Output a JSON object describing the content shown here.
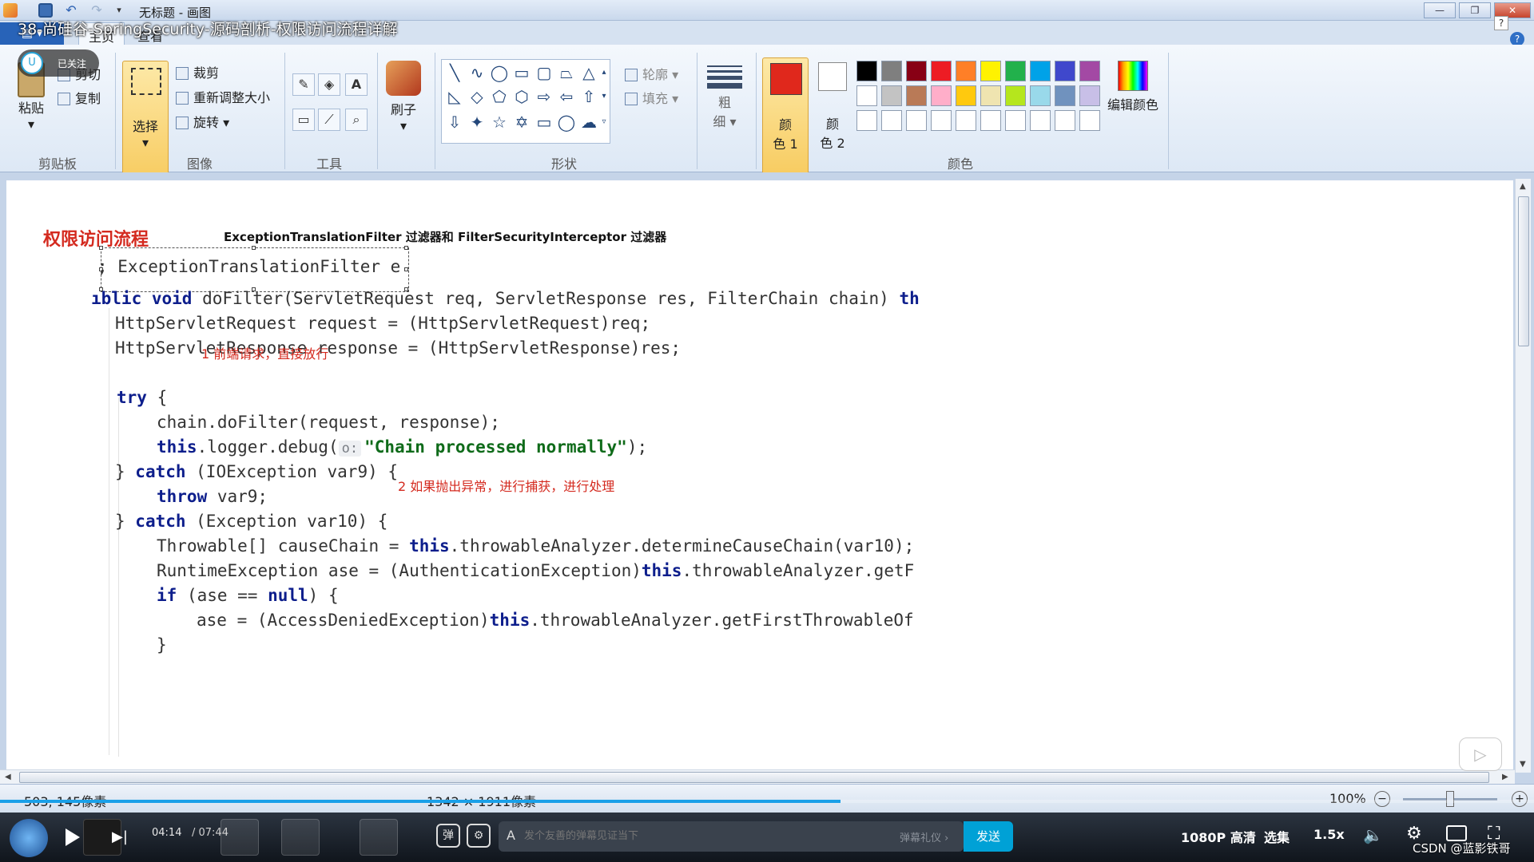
{
  "window": {
    "title": "无标题 - 画图"
  },
  "video": {
    "title": "38-尚硅谷-SpringSecurity-源码剖析-权限访问流程详解",
    "uploader_status": "已关注",
    "uploader_avatar_text": "U"
  },
  "ribbon": {
    "tabs": {
      "home": "主页",
      "view": "查看"
    },
    "clipboard": {
      "paste": "粘贴",
      "cut": "剪切",
      "copy": "复制",
      "label": "剪贴板"
    },
    "image": {
      "select": "选择",
      "crop": "裁剪",
      "resize": "重新调整大小",
      "rotate": "旋转",
      "label": "图像"
    },
    "tools": {
      "label": "工具"
    },
    "brushes": {
      "label": "刷子"
    },
    "shapes": {
      "outline": "轮廓",
      "fill": "填充",
      "label": "形状"
    },
    "size": {
      "label_top": "粗",
      "label_bottom": "细"
    },
    "colors": {
      "color1_top": "颜",
      "color1_bottom": "色 1",
      "color2_top": "颜",
      "color2_bottom": "色 2",
      "edit": "编辑颜色",
      "label": "颜色",
      "color1_value": "#e0281c",
      "palette_row1": [
        "#000000",
        "#7f7f7f",
        "#880015",
        "#ed1c24",
        "#ff7f27",
        "#fff200",
        "#22b14c",
        "#00a2e8",
        "#3f48cc",
        "#a349a4"
      ],
      "palette_row2": [
        "#ffffff",
        "#c3c3c3",
        "#b97a57",
        "#ffaec9",
        "#ffc90e",
        "#efe4b0",
        "#b5e61d",
        "#99d9ea",
        "#7092be",
        "#c8bfe7"
      ]
    }
  },
  "canvas": {
    "heading": "权限访问流程",
    "subheading": "ExceptionTranslationFilter 过滤器和 FilterSecurityInterceptor 过滤器",
    "class_line": "; ExceptionTranslationFilter e",
    "code": {
      "l1_kw": "ıblic void",
      "l1_rest": " doFilter(ServletRequest req, ServletResponse res, FilterChain chain) ",
      "l1_tail": "th",
      "l2": "HttpServletRequest request = (HttpServletRequest)req;",
      "l3": "HttpServletResponse response = (HttpServletResponse)res;",
      "l4_kw": "try",
      "l4_rest": " {",
      "l5": "chain.doFilter(request, response);",
      "l6_kw": "this",
      "l6_rest": ".logger.debug(",
      "l6_hint": "o:",
      "l6_str": "\"Chain processed normally\"",
      "l6_end": ");",
      "l7_open": "} ",
      "l7_kw": "catch",
      "l7_rest": " (IOException var9) {",
      "l8_kw": "throw",
      "l8_rest": " var9;",
      "l9_open": "} ",
      "l9_kw": "catch",
      "l9_rest": " (Exception var10) {",
      "l10_a": "Throwable[] causeChain = ",
      "l10_kw": "this",
      "l10_b": ".throwableAnalyzer.determineCauseChain(var10);",
      "l11_a": "RuntimeException ase = (AuthenticationException)",
      "l11_kw": "this",
      "l11_b": ".throwableAnalyzer.getF",
      "l12_kw": "if",
      "l12_a": " (ase == ",
      "l12_kw2": "null",
      "l12_b": ") {",
      "l13_a": "ase = (AccessDeniedException)",
      "l13_kw": "this",
      "l13_b": ".throwableAnalyzer.getFirstThrowableOf",
      "l14": "}"
    },
    "annotations": {
      "a1": "1  前端请求，直接放行",
      "a2": "2  如果抛出异常，进行捕获，进行处理"
    }
  },
  "statusbar": {
    "cursor_position": "503, 145像素",
    "canvas_size": "1342 × 1911像素",
    "zoom": "100%"
  },
  "player": {
    "time_current": "04:14",
    "time_total": "/ 07:44",
    "progress": 0.548,
    "danmaku_placeholder": "发个友善的弹幕见证当下",
    "etiquette": "弹幕礼仪 ›",
    "send": "发送",
    "quality": "1080P 高清",
    "episodes": "选集",
    "speed": "1.5x",
    "watermark": "CSDN @蓝影铁哥"
  }
}
